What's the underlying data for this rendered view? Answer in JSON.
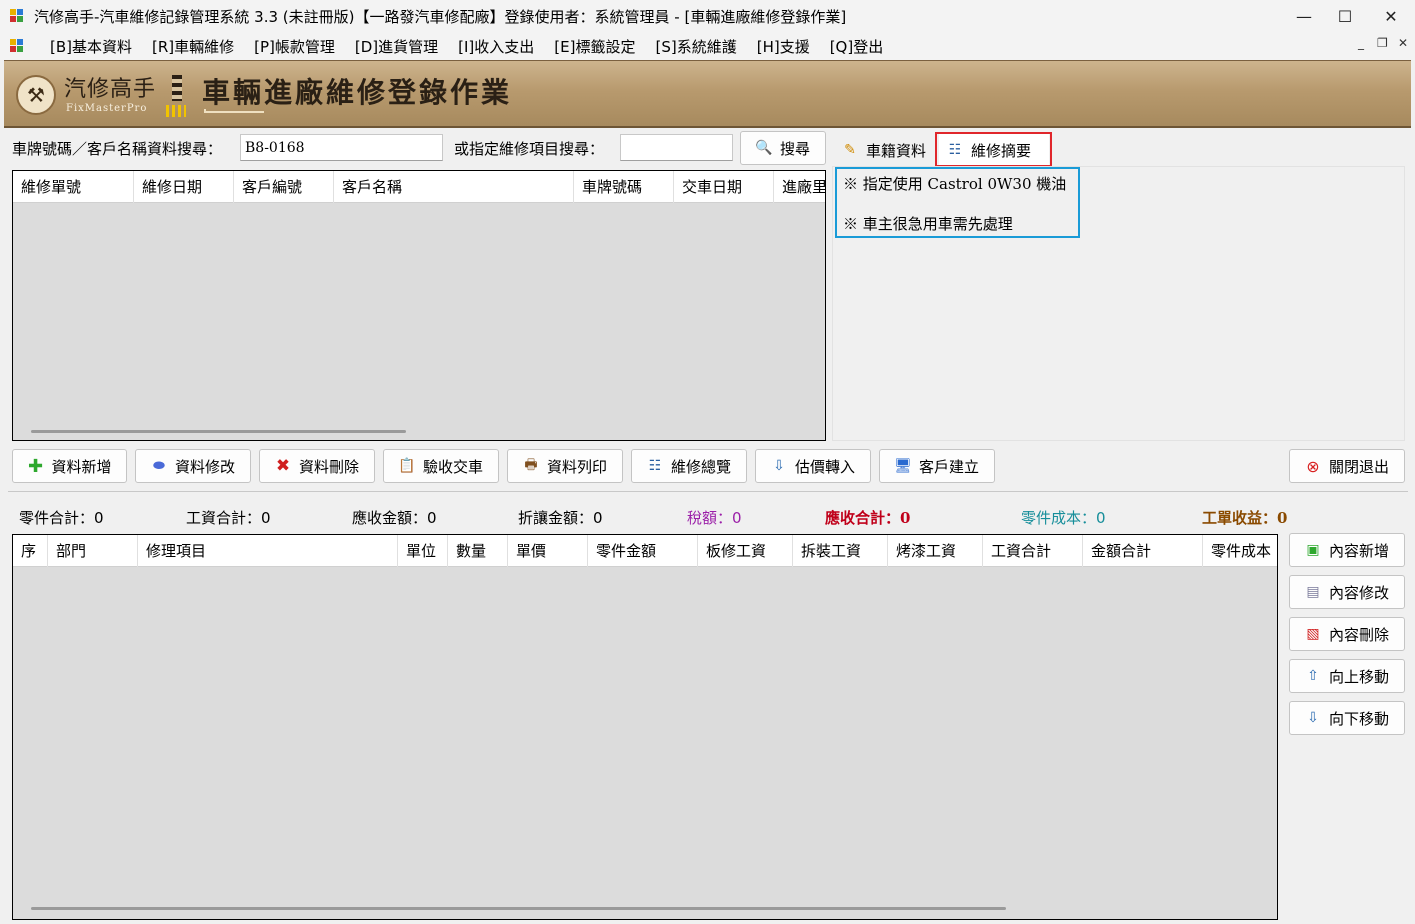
{
  "window": {
    "title": "汽修高手-汽車維修記錄管理系統 3.3 (未註冊版)【一路發汽車修配廠】登錄使用者：系統管理員 - [車輛進廠維修登錄作業]",
    "minimize": "—",
    "maximize": "☐",
    "close": "✕"
  },
  "menu": [
    "[B]基本資料",
    "[R]車輛維修",
    "[P]帳款管理",
    "[D]進貨管理",
    "[I]收入支出",
    "[E]標籤設定",
    "[S]系統維護",
    "[H]支援",
    "[Q]登出"
  ],
  "mdi_controls": {
    "minimize": "_",
    "restore": "❐",
    "close": "✕"
  },
  "banner": {
    "app_name": "汽修高手",
    "app_sub": "FixMasterPro",
    "page_title": "車輛進廠維修登錄作業"
  },
  "search": {
    "plate_label": "車牌號碼／客戶名稱資料搜尋：",
    "plate_value": "B8-0168",
    "item_label": "或指定維修項目搜尋：",
    "item_value": "",
    "search_button": "搜尋"
  },
  "orders_grid": {
    "columns": [
      "維修單號",
      "維修日期",
      "客戶編號",
      "客戶名稱",
      "車牌號碼",
      "交車日期",
      "進廠里"
    ],
    "rows": []
  },
  "tabs": {
    "vehicle": "車籍資料",
    "summary": "維修摘要"
  },
  "summary_notes": [
    "※ 指定使用 Castrol 0W30 機油",
    "※ 車主很急用車需先處理"
  ],
  "toolbar": {
    "add": "資料新增",
    "edit": "資料修改",
    "delete": "資料刪除",
    "accept": "驗收交車",
    "print": "資料列印",
    "overview": "維修總覽",
    "estimate": "估價轉入",
    "customer": "客戶建立",
    "exit": "關閉退出"
  },
  "totals": {
    "parts": "零件合計：0",
    "labor": "工資合計：0",
    "receivable": "應收金額：0",
    "discount": "折讓金額：0",
    "tax": "稅額：0",
    "total_due": "應收合計：0",
    "parts_cost": "零件成本：0",
    "profit": "工單收益：0"
  },
  "colors": {
    "tax": "#9b1fa8",
    "total_due": "#c0001a",
    "parts_cost": "#168e9a",
    "profit": "#8a4a00"
  },
  "items_grid": {
    "columns": [
      "序",
      "部門",
      "修理項目",
      "單位",
      "數量",
      "單價",
      "零件金額",
      "板修工資",
      "拆裝工資",
      "烤漆工資",
      "工資合計",
      "金額合計",
      "零件成本"
    ],
    "rows": []
  },
  "side_buttons": {
    "add": "內容新增",
    "edit": "內容修改",
    "delete": "內容刪除",
    "up": "向上移動",
    "down": "向下移動"
  }
}
